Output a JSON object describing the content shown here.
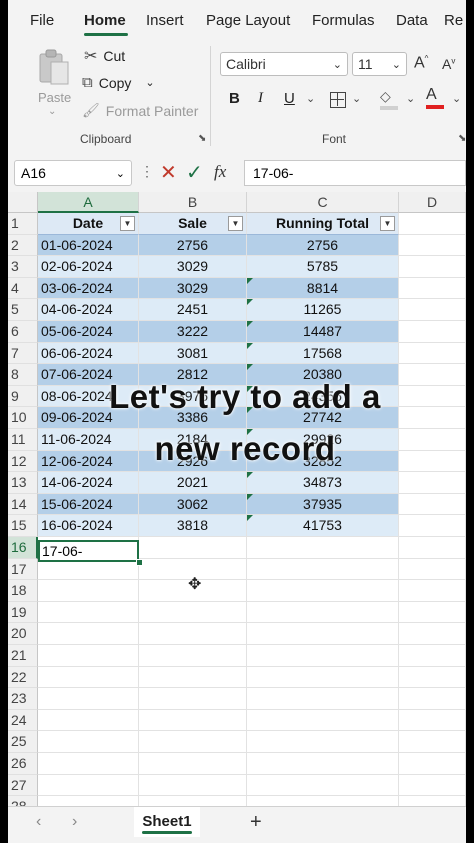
{
  "menu": {
    "tabs": [
      "File",
      "Home",
      "Insert",
      "Page Layout",
      "Formulas",
      "Data",
      "Re"
    ],
    "active": "Home"
  },
  "ribbon": {
    "clipboard": {
      "paste_label": "Paste",
      "cut_label": "Cut",
      "copy_label": "Copy",
      "format_painter_label": "Format Painter",
      "group_label": "Clipboard"
    },
    "font": {
      "font_name": "Calibri",
      "font_size": "11",
      "group_label": "Font",
      "bold": "B",
      "italic": "I",
      "underline": "U"
    }
  },
  "formula_bar": {
    "name_box": "A16",
    "fx_label": "fx",
    "formula_value": "17-06-"
  },
  "grid": {
    "columns": [
      "A",
      "B",
      "C",
      "D"
    ],
    "row_numbers": [
      "1",
      "2",
      "3",
      "4",
      "5",
      "6",
      "7",
      "8",
      "9",
      "10",
      "11",
      "12",
      "13",
      "14",
      "15",
      "16",
      "17",
      "18",
      "19",
      "20",
      "21",
      "22",
      "23",
      "24",
      "25",
      "26",
      "27",
      "28"
    ],
    "headers": [
      "Date",
      "Sale",
      "Running Total"
    ],
    "rows": [
      [
        "01-06-2024",
        "2756",
        "2756"
      ],
      [
        "02-06-2024",
        "3029",
        "5785"
      ],
      [
        "03-06-2024",
        "3029",
        "8814"
      ],
      [
        "04-06-2024",
        "2451",
        "11265"
      ],
      [
        "05-06-2024",
        "3222",
        "14487"
      ],
      [
        "06-06-2024",
        "3081",
        "17568"
      ],
      [
        "07-06-2024",
        "2812",
        "20380"
      ],
      [
        "08-06-2024",
        "3976",
        "24356"
      ],
      [
        "09-06-2024",
        "3386",
        "27742"
      ],
      [
        "11-06-2024",
        "2184",
        "29926"
      ],
      [
        "12-06-2024",
        "2926",
        "32852"
      ],
      [
        "14-06-2024",
        "2021",
        "34873"
      ],
      [
        "15-06-2024",
        "3062",
        "37935"
      ],
      [
        "16-06-2024",
        "3818",
        "41753"
      ]
    ],
    "active_cell_value": "17-06-"
  },
  "overlay": {
    "line1": "Let's try to add a",
    "line2": "new record"
  },
  "sheets": {
    "active": "Sheet1",
    "add_label": "+"
  },
  "colors": {
    "accent": "#1e7145",
    "band_light": "#ddebf7",
    "band_dark": "#b4cfe8"
  }
}
